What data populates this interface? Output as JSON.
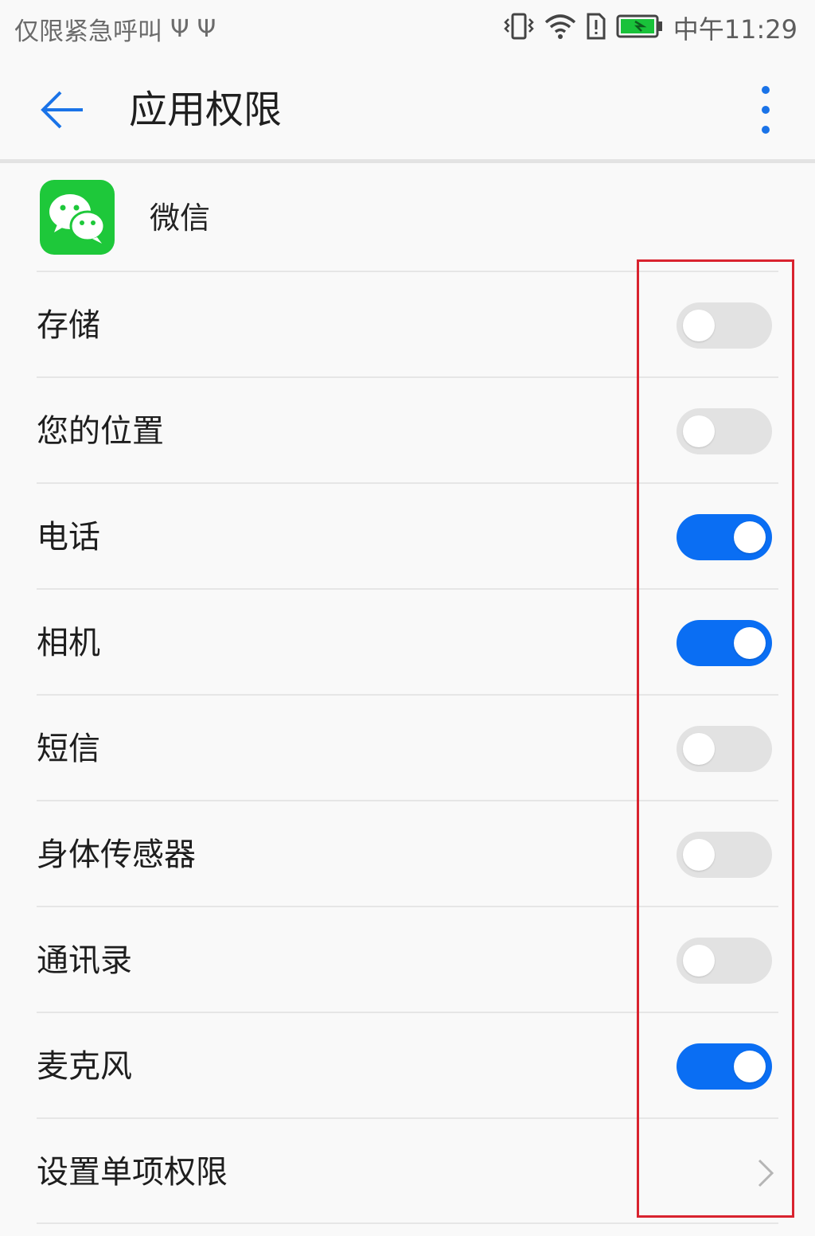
{
  "status_bar": {
    "carrier_text": "仅限紧急呼叫",
    "usb_icons": [
      "usb-icon",
      "usb-icon"
    ],
    "time": "中午11:29",
    "icons": [
      "vibrate-icon",
      "wifi-icon",
      "sim-alert-icon",
      "battery-charging-icon"
    ]
  },
  "app_bar": {
    "back_icon": "arrow-left-icon",
    "title": "应用权限",
    "more_icon": "more-vertical-icon"
  },
  "app": {
    "name": "微信",
    "icon": "wechat-icon",
    "brand_color": "#1EC83A"
  },
  "permissions": [
    {
      "label": "存储",
      "enabled": false
    },
    {
      "label": "您的位置",
      "enabled": false
    },
    {
      "label": "电话",
      "enabled": true
    },
    {
      "label": "相机",
      "enabled": true
    },
    {
      "label": "短信",
      "enabled": false
    },
    {
      "label": "身体传感器",
      "enabled": false
    },
    {
      "label": "通讯录",
      "enabled": false
    },
    {
      "label": "麦克风",
      "enabled": true
    }
  ],
  "single_permission": {
    "label": "设置单项权限",
    "icon": "chevron-right-icon"
  },
  "colors": {
    "accent": "#0A6EF3",
    "toggle_off": "#E2E2E2",
    "highlight": "#D9232F"
  }
}
